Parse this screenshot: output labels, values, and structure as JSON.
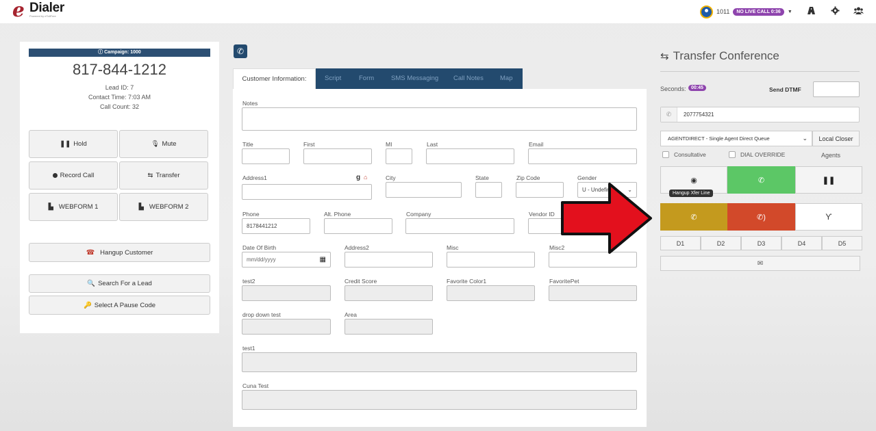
{
  "header": {
    "logo_e": "e",
    "logo_word": "Dialer",
    "logo_tagline": "Powered by eTollFree",
    "extension": "1011",
    "status_badge": "NO LIVE CALL 0:36"
  },
  "left": {
    "campaign": "Campaign: 1000",
    "phone": "817-844-1212",
    "lead_id": "Lead ID: 7",
    "contact_time": "Contact Time: 7:03 AM",
    "call_count": "Call Count: 32",
    "hold": "Hold",
    "mute": "Mute",
    "record_call": "Record Call",
    "transfer": "Transfer",
    "webform1": "WEBFORM 1",
    "webform2": "WEBFORM 2",
    "hangup": "Hangup Customer",
    "search_lead": "Search For a Lead",
    "pause_code": "Select A Pause Code"
  },
  "tabs": [
    "Customer Information:",
    "Script",
    "Form",
    "SMS Messaging",
    "Call Notes",
    "Map"
  ],
  "form": {
    "notes": "Notes",
    "title": "Title",
    "first": "First",
    "mi": "MI",
    "last": "Last",
    "email": "Email",
    "address1": "Address1",
    "city": "City",
    "state": "State",
    "zip": "Zip Code",
    "gender": "Gender",
    "gender_value": "U - Undefined",
    "phone": "Phone",
    "phone_value": "8178441212",
    "alt_phone": "Alt. Phone",
    "company": "Company",
    "vendor_id": "Vendor ID",
    "dob": "Date Of Birth",
    "dob_placeholder": "mm/dd/yyyy",
    "address2": "Address2",
    "misc": "Misc",
    "misc2": "Misc2",
    "test2": "test2",
    "credit_score": "Credit Score",
    "fav_color": "Favorite Color1",
    "fav_pet": "FavoritePet",
    "dropdown_test": "drop down test",
    "area": "Area",
    "test1": "test1",
    "cuna_test": "Cuna Test"
  },
  "transfer": {
    "title": "Transfer Conference",
    "seconds_label": "Seconds:",
    "seconds_value": "00:45",
    "send_dtmf": "Send DTMF",
    "number": "2077754321",
    "queue": "AGENTDIRECT - Single Agent Direct Queue",
    "local_closer": "Local Closer",
    "consultative": "Consultative",
    "dial_override": "DIAL OVERRIDE",
    "agents": "Agents",
    "tooltip": "Hangup Xfer Line",
    "d_buttons": [
      "D1",
      "D2",
      "D3",
      "D4",
      "D5"
    ]
  },
  "colors": {
    "navy": "#234a6e",
    "green": "#5cc766",
    "mustard": "#c49a1e",
    "orange_red": "#d2492a",
    "purple": "#8e44ad",
    "arrow_red": "#e3101d"
  }
}
